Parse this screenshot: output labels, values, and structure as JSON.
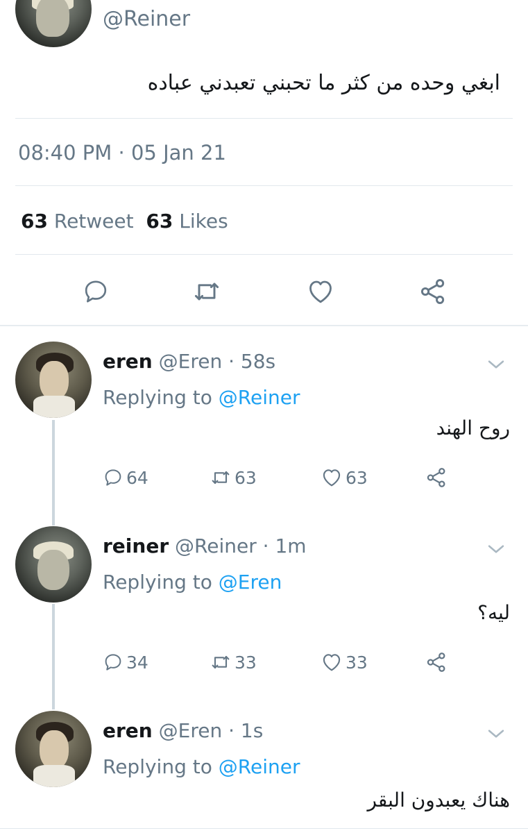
{
  "main_tweet": {
    "handle": "@Reiner",
    "text": "ابغي وحده من كثر ما تحبني تعبدني عباده",
    "timestamp": "08:40 PM · 05 Jan 21",
    "retweets": "63",
    "retweets_label": "Retweet",
    "likes": "63",
    "likes_label": "Likes",
    "actions": [
      "reply-icon",
      "retweet-icon",
      "like-icon",
      "share-icon"
    ]
  },
  "replies": [
    {
      "name": "eren",
      "handle": "@Eren",
      "dot": "·",
      "time": "58s",
      "replying_prefix": "Replying to",
      "replying_to": "@Reiner",
      "text": "روح الهند",
      "reply_count": "64",
      "retweet_count": "63",
      "like_count": "63"
    },
    {
      "name": "reiner",
      "handle": "@Reiner",
      "dot": "·",
      "time": "1m",
      "replying_prefix": "Replying to",
      "replying_to": "@Eren",
      "text": "ليه؟",
      "reply_count": "34",
      "retweet_count": "33",
      "like_count": "33"
    },
    {
      "name": "eren",
      "handle": "@Eren",
      "dot": "·",
      "time": "1s",
      "replying_prefix": "Replying to",
      "replying_to": "@Reiner",
      "text": "هناك يعبدون البقر"
    }
  ],
  "colors": {
    "text": "#14171a",
    "muted": "#657786",
    "link": "#1da1f2",
    "divider": "#e1e8ed",
    "thread_line": "#ccd6dd"
  }
}
